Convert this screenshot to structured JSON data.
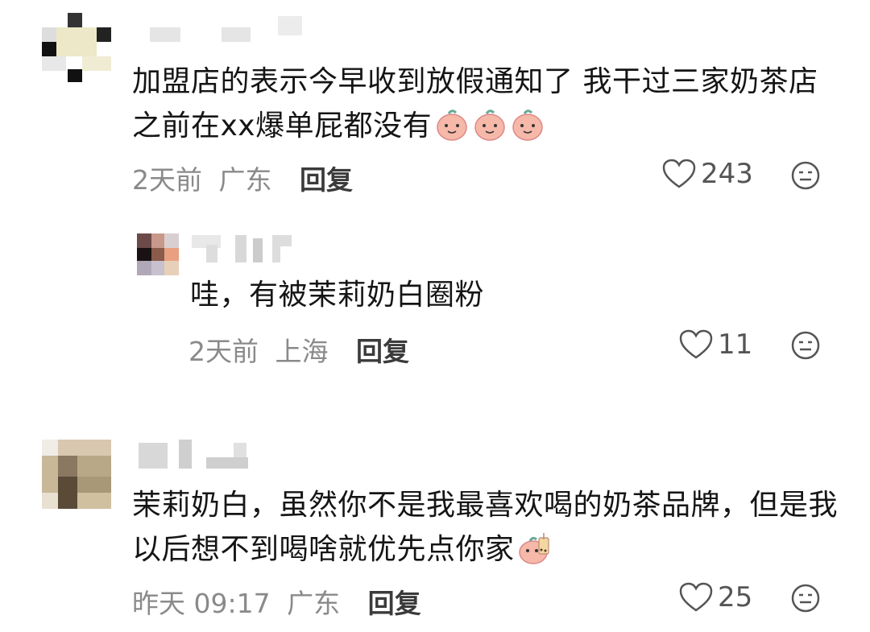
{
  "comments": [
    {
      "text": "加盟店的表示今早收到放假通知了 我干过三家奶茶店 之前在xx爆单屁都没有",
      "emoji": [
        "peach-smile-emoji",
        "peach-smile-emoji",
        "peach-smile-emoji"
      ],
      "time": "2天前",
      "location": "广东",
      "reply_label": "回复",
      "likes": "243"
    },
    {
      "text": "哇，有被茉莉奶白圈粉",
      "time": "2天前",
      "location": "上海",
      "reply_label": "回复",
      "likes": "11"
    },
    {
      "text": "茉莉奶白，虽然你不是我最喜欢喝的奶茶品牌，但是我以后想不到喝啥就优先点你家",
      "emoji": [
        "peach-milktea-emoji"
      ],
      "time": "昨天 09:17",
      "location": "广东",
      "reply_label": "回复",
      "likes": "25"
    }
  ],
  "colors": {
    "text": "#151515",
    "meta": "#8a8a8a",
    "reply": "#3b3b3b",
    "icon": "#555555",
    "emoji_fill": "#f6b8a8"
  }
}
